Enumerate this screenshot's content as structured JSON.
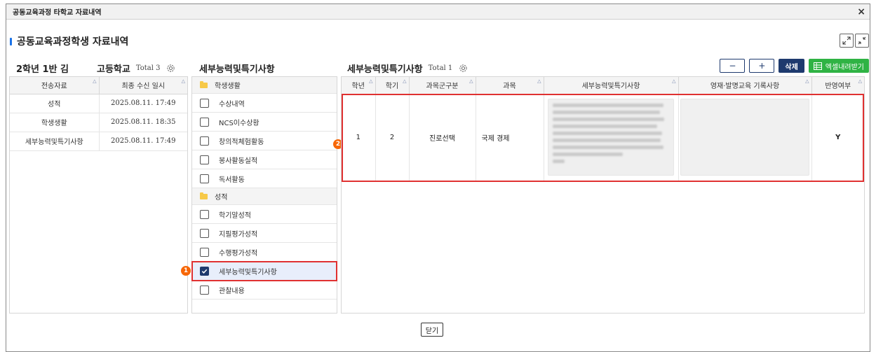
{
  "window": {
    "title": "공동교육과정 타학교 자료내역",
    "close_label": "×"
  },
  "page": {
    "title": "공동교육과정학생 자료내역"
  },
  "left": {
    "student": "2학년 1반 김",
    "school": "고등학교",
    "total": "Total 3",
    "columns": [
      "전송자료",
      "최종 수신 일시"
    ],
    "rows": [
      {
        "item": "성적",
        "time": "2025.08.11. 17:49"
      },
      {
        "item": "학생생활",
        "time": "2025.08.11. 18:35"
      },
      {
        "item": "세부능력및특기사항",
        "time": "2025.08.11. 17:49"
      }
    ]
  },
  "middle": {
    "title": "세부능력및특기사항",
    "groups": [
      {
        "label": "학생생활",
        "items": [
          "수상내역",
          "NCS이수상황",
          "창의적체험활동",
          "봉사활동실적",
          "독서활동"
        ]
      },
      {
        "label": "성적",
        "items": [
          "학기말성적",
          "지필평가성적",
          "수행평가성적",
          "세부능력및특기사항",
          "관찰내용"
        ]
      }
    ],
    "selected_item": "세부능력및특기사항"
  },
  "right": {
    "title": "세부능력및특기사항",
    "total": "Total 1",
    "columns": [
      "학년",
      "학기",
      "과목군구분",
      "과목",
      "세부능력및특기사항",
      "영재·발명교육 기록사항",
      "반영여부"
    ],
    "row": {
      "grade": "1",
      "semester": "2",
      "category": "진로선택",
      "subject": "국제 경제",
      "details": "",
      "gifted": "",
      "applied": "Y"
    },
    "buttons": {
      "minus": "−",
      "plus": "+",
      "delete": "삭제",
      "excel": "엑셀내려받기"
    }
  },
  "annotations": {
    "badge1": "1",
    "badge2": "2"
  },
  "footer": {
    "close": "닫기"
  },
  "colors": {
    "accent": "#1e3a6e",
    "excel": "#2fb344",
    "highlight": "#e03131",
    "badge": "#f76707"
  }
}
